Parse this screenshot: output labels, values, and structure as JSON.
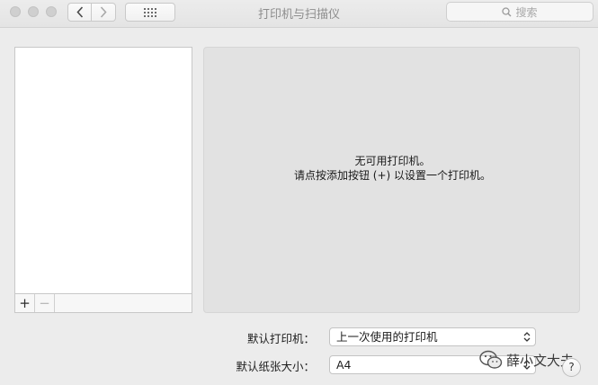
{
  "window": {
    "title": "打印机与扫描仪"
  },
  "toolbar": {
    "search_placeholder": "搜索"
  },
  "printer_list": {
    "add_label": "+",
    "remove_label": "−"
  },
  "detail": {
    "empty_line1": "无可用打印机。",
    "empty_line2": "请点按添加按钮 (+) 以设置一个打印机。"
  },
  "settings": {
    "default_printer_label": "默认打印机：",
    "default_printer_value": "上一次使用的打印机",
    "paper_size_label": "默认纸张大小：",
    "paper_size_value": "A4"
  },
  "help_label": "?",
  "watermark": {
    "text": "薛小文大夫"
  },
  "colors": {
    "window_bg": "#ececec",
    "panel_bg": "#e2e2e2",
    "list_bg": "#ffffff"
  },
  "icons": [
    "back-chevron-icon",
    "forward-chevron-icon",
    "grid-icon",
    "search-icon",
    "popup-arrows-icon",
    "wechat-icon"
  ]
}
